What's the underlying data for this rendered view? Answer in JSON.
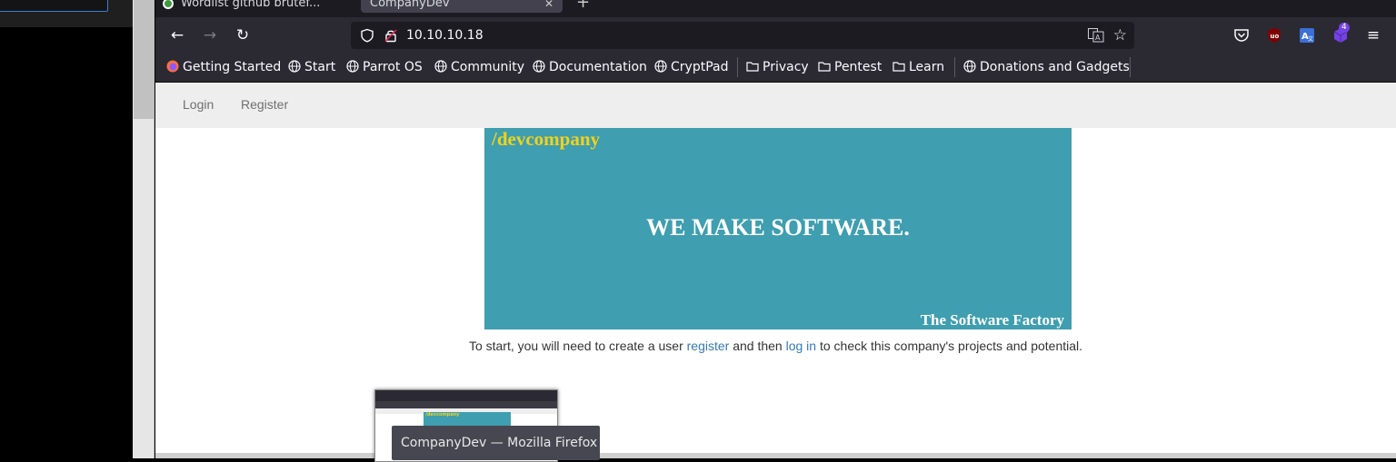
{
  "browser": {
    "tabs": [
      {
        "title": "Wordlist github brutef..."
      },
      {
        "title": "CompanyDev"
      }
    ],
    "url": "10.10.10.18",
    "extension_badge": "4",
    "bookmarks": [
      {
        "label": "Getting Started",
        "icon": "firefox-icon"
      },
      {
        "label": "Start",
        "icon": "globe-icon"
      },
      {
        "label": "Parrot OS",
        "icon": "globe-icon"
      },
      {
        "label": "Community",
        "icon": "globe-icon"
      },
      {
        "label": "Documentation",
        "icon": "globe-icon"
      },
      {
        "label": "CryptPad",
        "icon": "globe-icon"
      },
      {
        "label": "Privacy",
        "icon": "folder-icon"
      },
      {
        "label": "Pentest",
        "icon": "folder-icon"
      },
      {
        "label": "Learn",
        "icon": "folder-icon"
      },
      {
        "label": "Donations and Gadgets",
        "icon": "globe-icon"
      }
    ]
  },
  "page": {
    "nav": {
      "login": "Login",
      "register": "Register"
    },
    "hero": {
      "brand": "/devcompany",
      "headline": "WE MAKE SOFTWARE.",
      "tagline": "The Software Factory"
    },
    "intro": {
      "before": "To start, you will need to create a user ",
      "register_link": "register",
      "middle": " and then ",
      "login_link": "log in",
      "after": " to check this company's projects and potential."
    }
  },
  "taskbar": {
    "preview_title": "CompanyDev — Mozilla Firefox"
  },
  "colors": {
    "hero_bg": "#3f9eaf",
    "brand": "#f2d21b",
    "link": "#337ab7",
    "toolbar": "#2b2a33"
  }
}
